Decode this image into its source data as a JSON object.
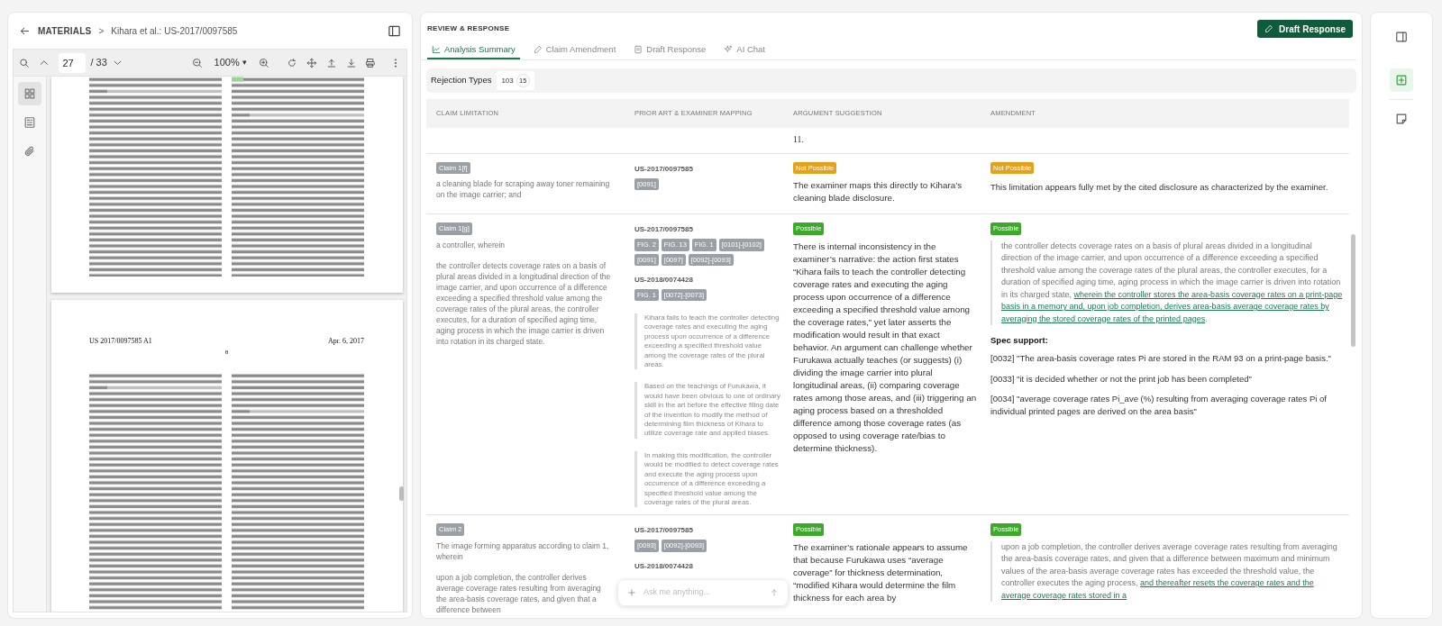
{
  "breadcrumb": {
    "section": "MATERIALS",
    "separator": ">",
    "document": "Kihara et al.: US-2017/0097585"
  },
  "viewer": {
    "page": "27",
    "page_count": "/ 33",
    "zoom": "100%",
    "zoom_caret": "▾",
    "rail": [
      {
        "selected": true
      },
      {
        "selected": false
      },
      {
        "selected": false
      }
    ],
    "page_header": {
      "number": "US 2017/0097585 A1",
      "date": "Apr. 6, 2017",
      "page": "8"
    }
  },
  "panel": {
    "title": "REVIEW & RESPONSE",
    "action": "Draft Response"
  },
  "tabs": [
    {
      "label": "Analysis Summary",
      "selected": true
    },
    {
      "label": "Claim Amendment",
      "selected": false
    },
    {
      "label": "Draft Response",
      "selected": false
    },
    {
      "label": "AI Chat",
      "selected": false
    }
  ],
  "rejection": {
    "label": "Rejection Types",
    "codes": [
      {
        "text": "103",
        "kind": "plain"
      },
      {
        "text": "15",
        "kind": "count"
      }
    ]
  },
  "table": {
    "columns": [
      "CLAIM LIMITATION",
      "PRIOR ART & EXAMINER MAPPING",
      "ARGUMENT SUGGESTION",
      "AMENDMENT"
    ],
    "rows": [
      {
        "argument": {
          "text": "11."
        }
      },
      {
        "claim": {
          "label": "Claim 1[f]",
          "text": "a cleaning blade for scraping away toner remaining on the image carrier; and"
        },
        "prior_art": [
          {
            "ref": "US-2017/0097585",
            "tags": [
              "[0091]"
            ]
          }
        ],
        "argument": {
          "verdict": {
            "label": "Not Possible",
            "kind": "not_possible"
          },
          "text": "The examiner maps this directly to Kihara’s cleaning blade disclosure."
        },
        "amendment": {
          "verdict": {
            "label": "Not Possible",
            "kind": "not_possible"
          },
          "text": "This limitation appears fully met by the cited disclosure as characterized by the examiner."
        }
      },
      {
        "claim": {
          "label": "Claim 1[g]",
          "preamble": "a controller, wherein",
          "text": "the controller detects coverage rates on a basis of plural areas divided in a longitudinal direction of the image carrier, and upon occurrence of a difference exceeding a specified threshold value among the coverage rates of the plural areas, the controller executes, for a duration of specified aging time, aging process in which the image carrier is driven into rotation in its charged state."
        },
        "prior_art": [
          {
            "ref": "US-2017/0097585",
            "tags": [
              "FIG. 2",
              "FIG. 13",
              "FIG. 1",
              "[0101]-[0102]",
              "[0091]",
              "[0097]",
              "[0092]-[0093]"
            ]
          },
          {
            "ref": "US-2018/0074428",
            "tags": [
              "FIG. 1",
              "[0072]-[0073]"
            ]
          }
        ],
        "quotes": [
          "Kihara fails to teach the controller detecting coverage rates and executing the aging process upon occurrence of a difference exceeding a specified threshold value among the coverage rates of the plural areas.",
          "Based on the teachings of Furukawa, it would have been obvious to one of ordinary skill in the art before the effective filing date of the invention to modify the method of determining film thickness of Kihara to utilize coverage rate and applied biases.",
          "In making this modification, the controller would be modified to detect coverage rates and execute the aging process upon occurrence of a difference exceeding a specified threshold value among the coverage rates of the plural areas."
        ],
        "argument": {
          "verdict": {
            "label": "Possible",
            "kind": "possible"
          },
          "text": "There is internal inconsistency in the examiner’s narrative: the action first states “Kihara fails to teach the controller detecting coverage rates and executing the aging process upon occurrence of a difference exceeding a specified threshold value among the coverage rates,” yet later asserts the modification would result in that exact behavior. An argument can challenge whether Furukawa actually teaches (or suggests) (i) dividing the image carrier into plural longitudinal areas, (ii) comparing coverage rates among those areas, and (iii) triggering an aging process based on a thresholded difference among those coverage rates (as opposed to using coverage rate/bias to determine thickness)."
        },
        "amendment": {
          "verdict": {
            "label": "Possible",
            "kind": "possible"
          },
          "quote": "the controller detects coverage rates on a basis of plural areas divided in a longitudinal direction of the image carrier, and upon occurrence of a difference exceeding a specified threshold value among the coverage rates of the plural areas, the controller executes, for a duration of specified aging time, aging process in which the image carrier is driven into rotation in its charged state,",
          "added": "wherein the controller stores the area-basis coverage rates on a print-page basis in a memory and, upon job completion, derives area-basis average coverage rates by averaging the stored coverage rates of the printed pages",
          "tail": ".",
          "spec_title": "Spec support:",
          "spec": [
            "[0032] \"The area-basis coverage rates Pi are stored in the RAM 93 on a print-page basis.\"",
            "[0033] \"it is decided whether or not the print job has been completed\"",
            "[0034] \"average coverage rates Pi_ave (%) resulting from averaging coverage rates Pi of individual printed pages are derived on the area basis\""
          ]
        }
      },
      {
        "claim": {
          "label": "Claim 2",
          "preamble": "The image forming apparatus according to claim 1, wherein",
          "text": "upon a job completion, the controller derives average coverage rates resulting from averaging the area-basis coverage rates, and given that a difference between"
        },
        "prior_art": [
          {
            "ref": "US-2017/0097585",
            "tags": [
              "[0093]",
              "[0092]-[0093]"
            ]
          },
          {
            "ref": "US-2018/0074428"
          }
        ],
        "argument": {
          "verdict": {
            "label": "Possible",
            "kind": "possible"
          },
          "text": "The examiner’s rationale appears to assume that because Furukawa uses “average coverage” for thickness determination, “modified Kihara would determine the film thickness for each area by"
        },
        "amendment": {
          "verdict": {
            "label": "Possible",
            "kind": "possible"
          },
          "quote": "upon a job completion, the controller derives average coverage rates resulting from averaging the area-basis coverage rates, and given that a difference between maximum and minimum values of the area-basis average coverage rates has exceeded the threshold value, the controller executes the aging process,",
          "added": "and thereafter resets the coverage rates and the average coverage rates stored in a"
        }
      }
    ]
  },
  "chat": {
    "placeholder": "Ask me anything..."
  },
  "right_rail": [
    {
      "selected": false
    },
    {
      "selected": true
    },
    {
      "selected": false
    }
  ]
}
